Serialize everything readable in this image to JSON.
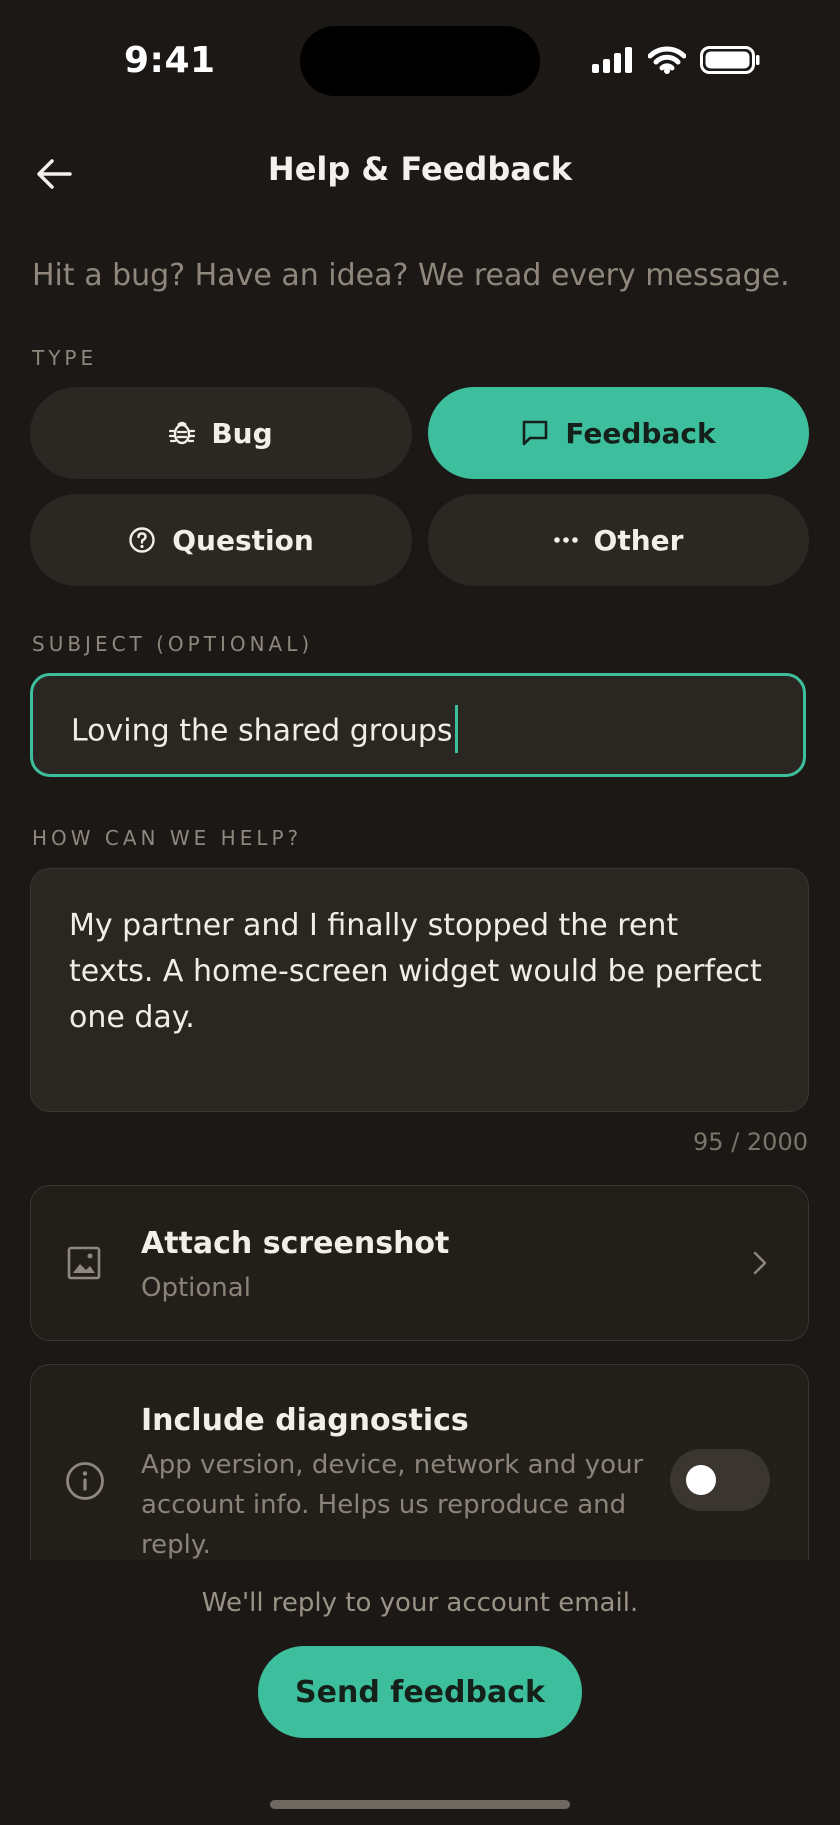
{
  "status_bar": {
    "time": "9:41"
  },
  "header": {
    "title": "Help & Feedback"
  },
  "intro": "Hit a bug? Have an idea? We read every message.",
  "type_section": {
    "label": "TYPE",
    "options": [
      {
        "label": "Bug",
        "icon": "bug-icon",
        "selected": false
      },
      {
        "label": "Feedback",
        "icon": "message-icon",
        "selected": true
      },
      {
        "label": "Question",
        "icon": "question-icon",
        "selected": false
      },
      {
        "label": "Other",
        "icon": "more-icon",
        "selected": false
      }
    ]
  },
  "subject": {
    "label": "SUBJECT (OPTIONAL)",
    "value": "Loving the shared groups"
  },
  "message": {
    "label": "HOW CAN WE HELP?",
    "value": "My partner and I finally stopped the rent texts. A home-screen widget would be perfect one day.",
    "counter": "95 / 2000"
  },
  "attach": {
    "title": "Attach screenshot",
    "subtitle": "Optional"
  },
  "diagnostics": {
    "title": "Include diagnostics",
    "description": "App version, device, network and your account info. Helps us reproduce and reply.",
    "enabled": false
  },
  "footer": {
    "reply_note": "We'll reply to your account email.",
    "send_label": "Send feedback"
  },
  "colors": {
    "accent": "#3dbf9e",
    "background": "#1b1815",
    "surface": "#2a2621"
  }
}
